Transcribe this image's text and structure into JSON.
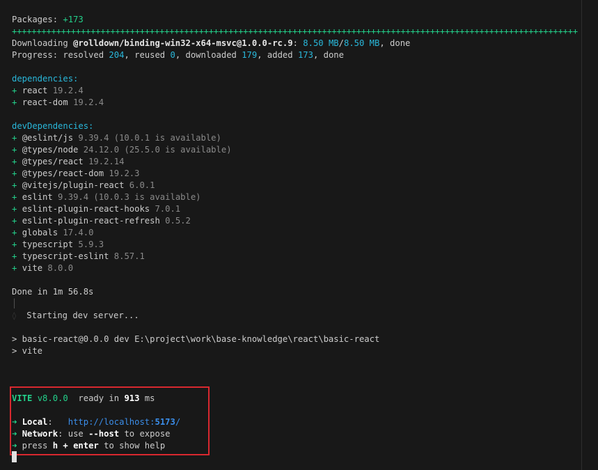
{
  "packages": {
    "label": "Packages: ",
    "count": "+173"
  },
  "progress_bar": "+++++++++++++++++++++++++++++++++++++++++++++++++++++++++++++++++++++++++++++++++++++++++++++++++++++++++++++++++++",
  "downloading": {
    "prefix": "Downloading ",
    "package": "@rolldown/binding-win32-x64-msvc@1.0.0-rc.9",
    "colon": ": ",
    "done_size": "8.50 MB",
    "slash": "/",
    "total_size": "8.50 MB",
    "suffix": ", done"
  },
  "progress": {
    "prefix": "Progress: resolved ",
    "resolved": "204",
    "reused_label": ", reused ",
    "reused": "0",
    "downloaded_label": ", downloaded ",
    "downloaded": "179",
    "added_label": ", added ",
    "added": "173",
    "suffix": ", done"
  },
  "dependencies": {
    "heading": "dependencies:",
    "items": [
      {
        "plus": "+ ",
        "name": "react",
        "version": " 19.2.4"
      },
      {
        "plus": "+ ",
        "name": "react-dom",
        "version": " 19.2.4"
      }
    ]
  },
  "devDependencies": {
    "heading": "devDependencies:",
    "items": [
      {
        "plus": "+ ",
        "name": "@eslint/js",
        "version": " 9.39.4 (10.0.1 is available)"
      },
      {
        "plus": "+ ",
        "name": "@types/node",
        "version": " 24.12.0 (25.5.0 is available)"
      },
      {
        "plus": "+ ",
        "name": "@types/react",
        "version": " 19.2.14"
      },
      {
        "plus": "+ ",
        "name": "@types/react-dom",
        "version": " 19.2.3"
      },
      {
        "plus": "+ ",
        "name": "@vitejs/plugin-react",
        "version": " 6.0.1"
      },
      {
        "plus": "+ ",
        "name": "eslint",
        "version": " 9.39.4 (10.0.3 is available)"
      },
      {
        "plus": "+ ",
        "name": "eslint-plugin-react-hooks",
        "version": " 7.0.1"
      },
      {
        "plus": "+ ",
        "name": "eslint-plugin-react-refresh",
        "version": " 0.5.2"
      },
      {
        "plus": "+ ",
        "name": "globals",
        "version": " 17.4.0"
      },
      {
        "plus": "+ ",
        "name": "typescript",
        "version": " 5.9.3"
      },
      {
        "plus": "+ ",
        "name": "typescript-eslint",
        "version": " 8.57.1"
      },
      {
        "plus": "+ ",
        "name": "vite",
        "version": " 8.0.0"
      }
    ]
  },
  "done_line": "Done in 1m 56.8s",
  "pipe_glyph": "│",
  "diamond_glyph": "◊",
  "starting": "  Starting dev server...",
  "script_lines": [
    "> basic-react@0.0.0 dev E:\\project\\work\\base-knowledge\\react\\basic-react",
    "> vite"
  ],
  "vite": {
    "name": "VITE",
    "version": " v8.0.0",
    "ready_label": "  ready in ",
    "ready_ms": "913",
    "ms_unit": " ms",
    "arrow": "➜",
    "local_label": "Local",
    "local_sep": ":   ",
    "local_url_prefix": "http://localhost:",
    "local_port": "5173",
    "local_url_suffix": "/",
    "network_label": "Network",
    "network_text_a": ": use ",
    "network_flag": "--host",
    "network_text_b": " to expose",
    "help_text_a": " press ",
    "help_key_h": "h",
    "help_plus": " + ",
    "help_key_enter": "enter",
    "help_text_b": " to show help"
  },
  "colors": {
    "background": "#181818",
    "green": "#23d18b",
    "blue": "#29b8db",
    "link": "#3b8eea",
    "dim": "#8a8a8a",
    "highlight_border": "#d8282f"
  }
}
